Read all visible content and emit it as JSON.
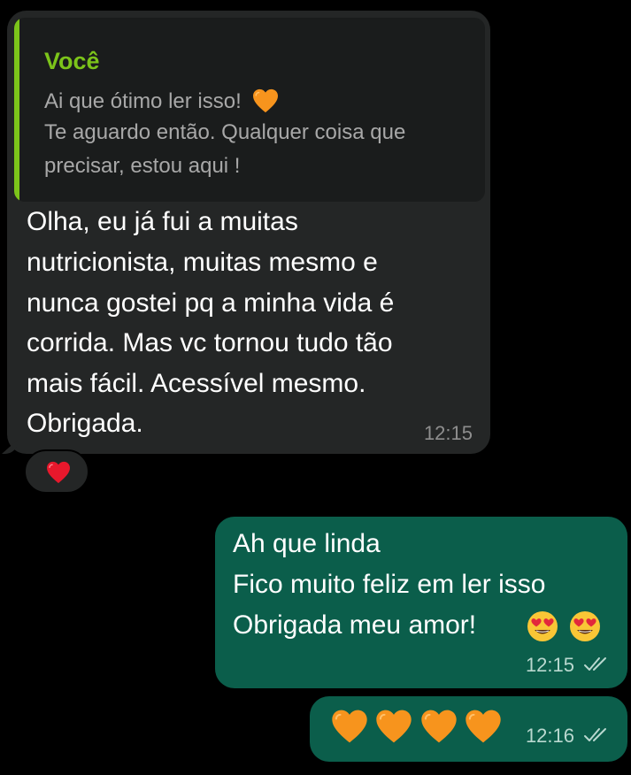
{
  "incoming_message": {
    "quote": {
      "author": "Você",
      "line1": "Ai que ótimo ler isso!",
      "line2": "Te aguardo então. Qualquer coisa que",
      "line3": "precisar, estou aqui !",
      "emoji": "orange-heart-icon"
    },
    "lines": [
      "Olha, eu já fui a muitas",
      "nutricionista, muitas mesmo e",
      "nunca gostei pq a minha vida é",
      "corrida. Mas vc tornou tudo tão",
      "mais fácil. Acessível mesmo.",
      "Obrigada."
    ],
    "time": "12:15",
    "reaction": "red-heart-icon"
  },
  "outgoing_messages": [
    {
      "lines": [
        "Ah que linda",
        "Fico muito feliz em ler isso",
        "Obrigada meu amor!"
      ],
      "emojis": [
        "heart-eyes-icon",
        "heart-eyes-icon"
      ],
      "time": "12:15",
      "status": "read"
    },
    {
      "emojis": [
        "orange-heart-icon",
        "orange-heart-icon",
        "orange-heart-icon",
        "orange-heart-icon"
      ],
      "time": "12:16",
      "status": "read"
    }
  ],
  "colors": {
    "background": "#000000",
    "incoming_bubble": "#242626",
    "outgoing_bubble": "#0b5e4b",
    "quote_accent": "#7cc41a",
    "orange_heart": "#f7941d",
    "red_heart": "#e8182c"
  }
}
